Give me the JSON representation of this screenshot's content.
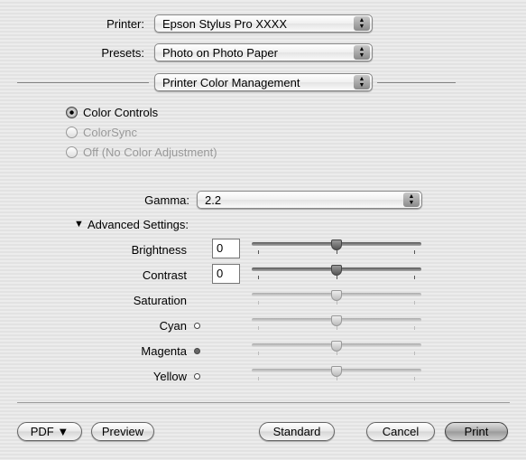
{
  "printer": {
    "label": "Printer:",
    "value": "Epson Stylus Pro XXXX"
  },
  "presets": {
    "label": "Presets:",
    "value": "Photo on Photo Paper"
  },
  "panel": {
    "value": "Printer Color Management"
  },
  "color_mode": {
    "options": [
      {
        "label": "Color Controls",
        "selected": true,
        "enabled": true
      },
      {
        "label": "ColorSync",
        "selected": false,
        "enabled": false
      },
      {
        "label": "Off (No Color Adjustment)",
        "selected": false,
        "enabled": false
      }
    ]
  },
  "gamma": {
    "label": "Gamma:",
    "value": "2.2"
  },
  "advanced": {
    "label": "Advanced Settings:",
    "expanded": true
  },
  "sliders": [
    {
      "label": "Brightness",
      "value": "0",
      "position": 0.5,
      "enabled": true
    },
    {
      "label": "Contrast",
      "value": "0",
      "position": 0.5,
      "enabled": true
    },
    {
      "label": "Saturation",
      "position": 0.5,
      "enabled": false
    },
    {
      "label": "Cyan",
      "position": 0.5,
      "enabled": false,
      "dot": "#ffffff"
    },
    {
      "label": "Magenta",
      "position": 0.5,
      "enabled": false,
      "dot": "#666666"
    },
    {
      "label": "Yellow",
      "position": 0.5,
      "enabled": false,
      "dot": "#ffffff"
    }
  ],
  "buttons": {
    "pdf": "PDF ▼",
    "preview": "Preview",
    "standard": "Standard",
    "cancel": "Cancel",
    "print": "Print"
  }
}
